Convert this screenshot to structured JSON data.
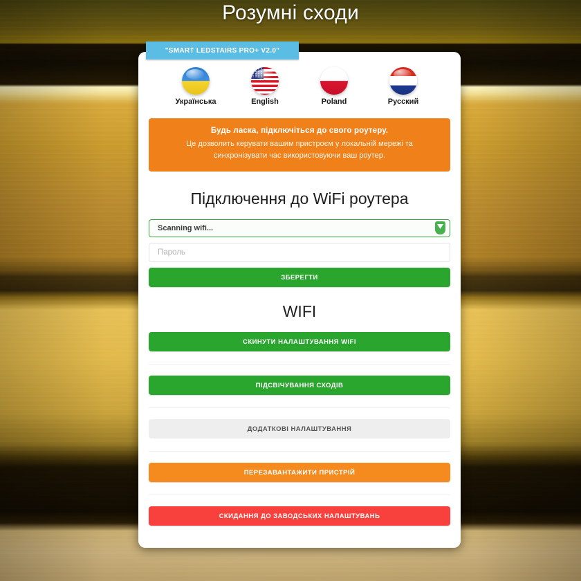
{
  "page": {
    "title": "Розумні сходи",
    "device_badge": "\"SMART LEDSTAIRS PRO+ V2.0\""
  },
  "languages": [
    {
      "label": "Українська",
      "flag": "ukraine-flag-icon"
    },
    {
      "label": "English",
      "flag": "usa-flag-icon"
    },
    {
      "label": "Poland",
      "flag": "poland-flag-icon"
    },
    {
      "label": "Русский",
      "flag": "russia-flag-icon"
    }
  ],
  "alert": {
    "title": "Будь ласка, підключіться до свого роутеру.",
    "line1": "Це дозволить керувати вашим пристроєм у локальній мережі та",
    "line2": "синхронізувати час використовуючи ваш роутер."
  },
  "wifi_connect": {
    "heading": "Підключення до WiFi роутера",
    "network_select_value": "Scanning wifi...",
    "password_placeholder": "Пароль",
    "save_label": "ЗБЕРЕГТИ"
  },
  "wifi_section": {
    "heading": "WIFI",
    "reset_wifi_label": "СКИНУТИ НАЛАШТУВАННЯ WIFI"
  },
  "actions": {
    "stairs_lighting_label": "ПІДСВІЧУВАННЯ СХОДІВ",
    "extra_settings_label": "ДОДАТКОВІ НАЛАШТУВАННЯ",
    "reboot_label": "ПЕРЕЗАВАНТАЖИТИ ПРИСТРІЙ",
    "factory_reset_label": "СКИДАННЯ ДО ЗАВОДСЬКИХ НАЛАШТУВАНЬ"
  },
  "colors": {
    "badge_blue": "#5bbce4",
    "alert_orange": "#f08019",
    "green": "#2aa62f",
    "orange": "#f58a1f",
    "red": "#f8403c",
    "grey": "#eeeeee"
  }
}
